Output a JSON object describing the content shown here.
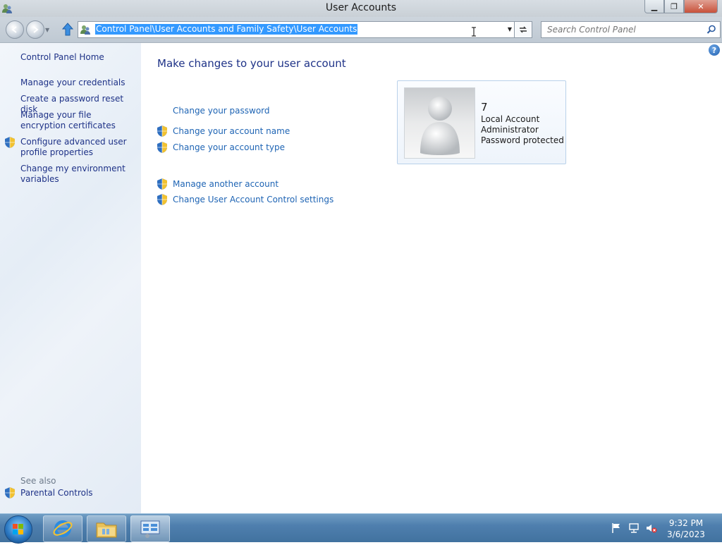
{
  "window": {
    "title": "User Accounts",
    "minimize_glyph": "▁",
    "restore_glyph": "❐",
    "close_glyph": "✕"
  },
  "navbar": {
    "back_icon": "back-arrow-icon",
    "forward_icon": "forward-arrow-icon",
    "address_path": "Control Panel\\User Accounts and Family Safety\\User Accounts",
    "search_placeholder": "Search Control Panel"
  },
  "sidebar": {
    "items": [
      {
        "label": "Control Panel Home",
        "shield": false
      },
      {
        "label": "Manage your credentials",
        "shield": false
      },
      {
        "label": "Create a password reset disk",
        "shield": false
      },
      {
        "label": "Manage your file encryption certificates",
        "shield": false
      },
      {
        "label": "Configure advanced user profile properties",
        "shield": true
      },
      {
        "label": "Change my environment variables",
        "shield": false
      }
    ],
    "see_also_label": "See also",
    "see_also_items": [
      {
        "label": "Parental Controls",
        "shield": true
      }
    ]
  },
  "main": {
    "help_glyph": "?",
    "title": "Make changes to your user account",
    "tasks": [
      {
        "label": "Change your password",
        "shield": false
      },
      {
        "label": "Change your account name",
        "shield": true
      },
      {
        "label": "Change your account type",
        "shield": true
      },
      {
        "label": "Manage another account",
        "shield": true
      },
      {
        "label": "Change User Account Control settings",
        "shield": true
      }
    ],
    "account": {
      "name": "7",
      "type": "Local Account",
      "role": "Administrator",
      "status": "Password protected"
    }
  },
  "taskbar": {
    "pinned": [
      "internet-explorer-icon",
      "file-explorer-icon",
      "control-panel-icon"
    ],
    "clock_time": "9:32 PM",
    "clock_date": "3/6/2023"
  },
  "colors": {
    "link": "#1e64b4",
    "sidebar_link": "#1e3287",
    "selection": "#3399ff",
    "shield_blue": "#2f6fc0",
    "shield_yellow": "#f2c230"
  }
}
